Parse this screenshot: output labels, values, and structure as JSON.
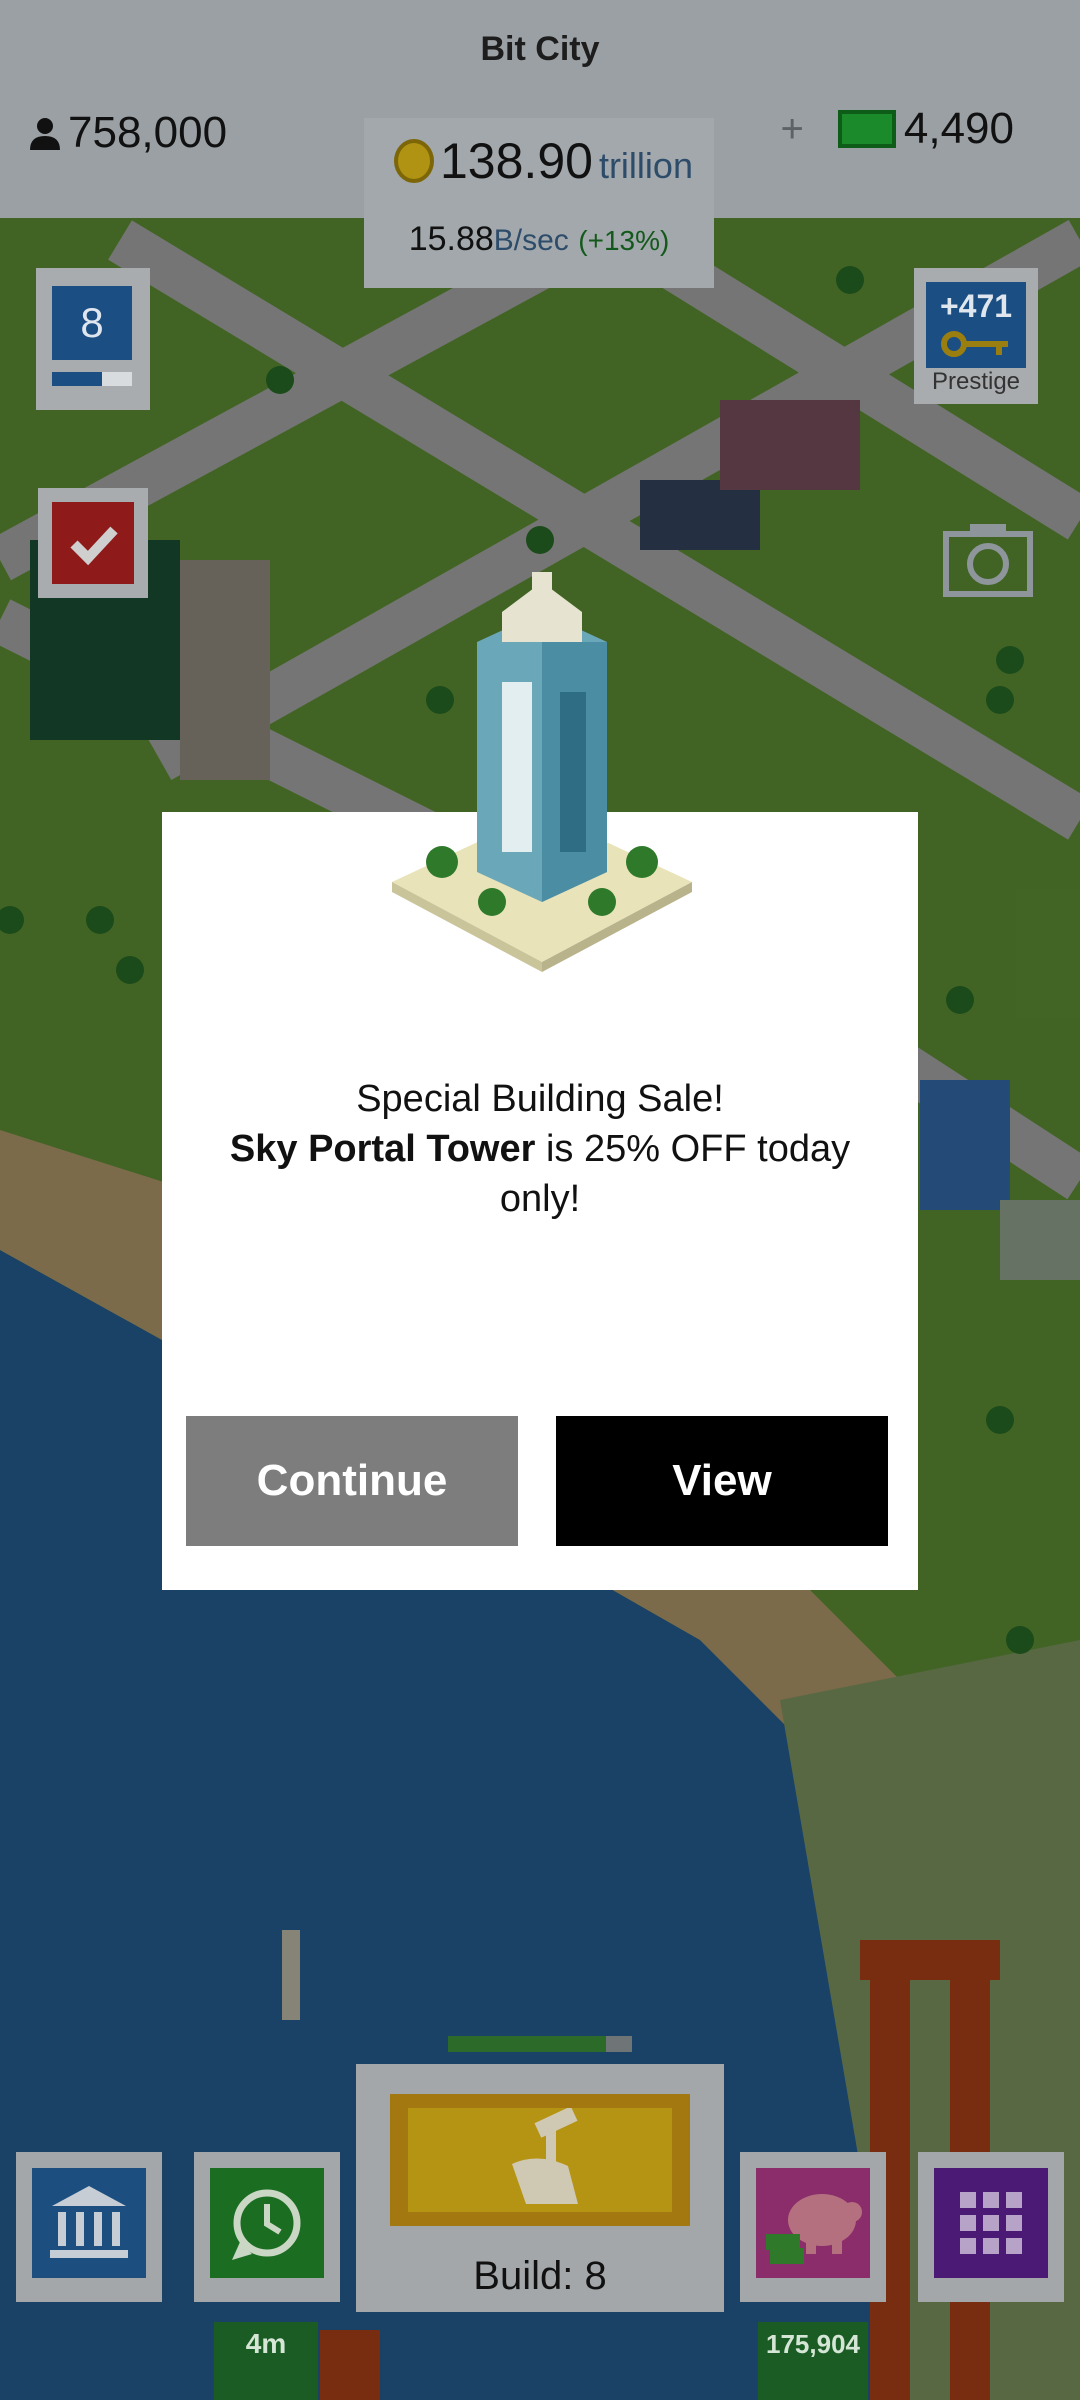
{
  "app": {
    "title": "Bit City"
  },
  "hud": {
    "population": "758,000",
    "coins_value": "138.90",
    "coins_unit": "trillion",
    "rate_value": "15.88",
    "rate_unit": "B/sec",
    "rate_bonus": "(+13%)",
    "cash_plus": "+",
    "cash": "4,490"
  },
  "side": {
    "level": "8",
    "level_progress": 0.62,
    "prestige_value": "+471",
    "prestige_label": "Prestige"
  },
  "modal": {
    "line1": "Special Building Sale!",
    "building_name": "Sky Portal Tower",
    "line2_rest": " is 25% OFF today only!",
    "continue_label": "Continue",
    "view_label": "View"
  },
  "bottom": {
    "build_label": "Build: 8",
    "build_progress": 0.86,
    "timer_tag": "4m",
    "savings_tag": "175,904"
  },
  "colors": {
    "level_blue": "#1b4e83",
    "check_red": "#8e1a1a",
    "cash_green": "#1a8a2a",
    "build_yellow": "#b59313",
    "view_black": "#000000",
    "continue_gray": "#7d7d7d"
  },
  "icons": [
    "person-icon",
    "coin-icon",
    "cash-icon",
    "checkmark-icon",
    "key-icon",
    "camera-icon",
    "hammer-hand-icon",
    "bank-icon",
    "clock-icon",
    "piggy-bank-icon",
    "grid-icon"
  ]
}
